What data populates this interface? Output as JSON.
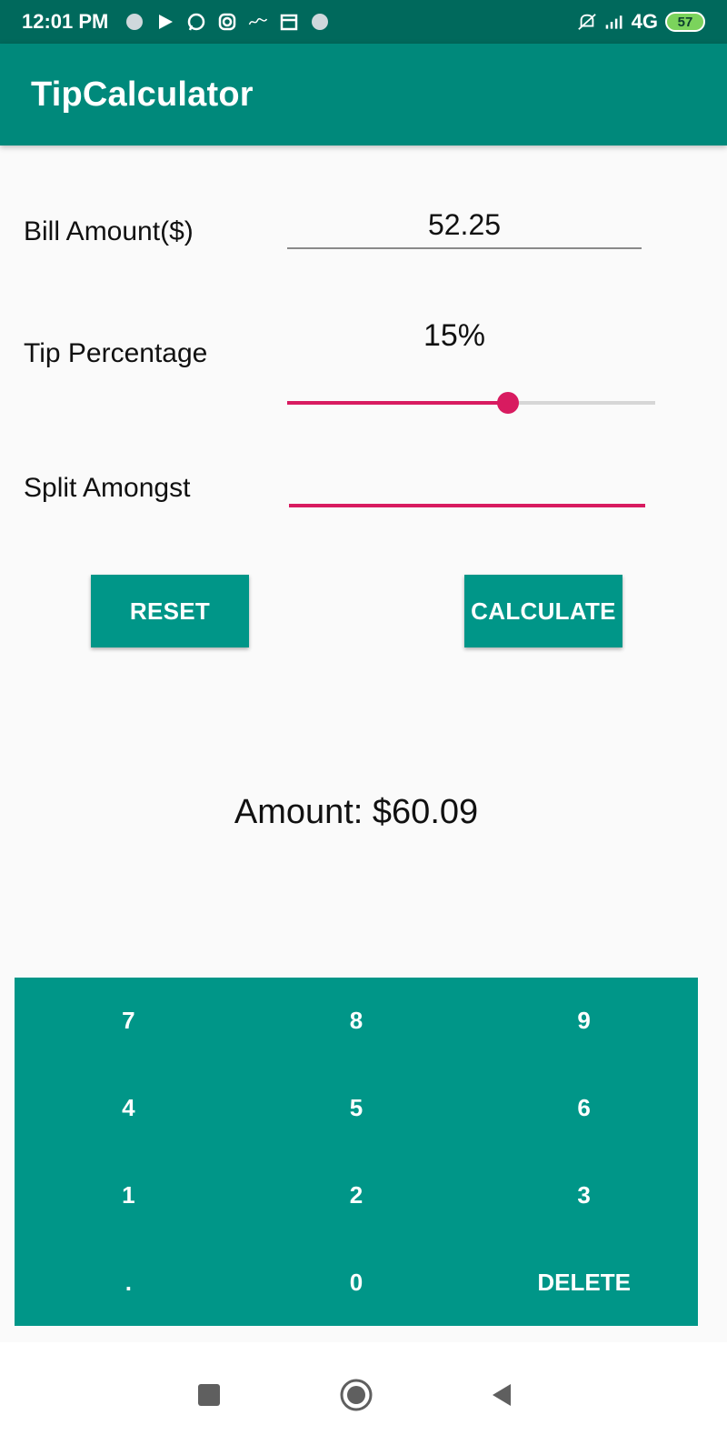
{
  "status_bar": {
    "time": "12:01 PM",
    "network": "4G",
    "battery": "57"
  },
  "app_bar": {
    "title": "TipCalculator"
  },
  "form": {
    "bill_label": "Bill Amount($)",
    "bill_value": "52.25",
    "tip_label": "Tip Percentage",
    "tip_value": "15%",
    "tip_slider_fraction": 0.6,
    "split_label": "Split Amongst",
    "split_value": ""
  },
  "buttons": {
    "reset": "RESET",
    "calculate": "CALCULATE"
  },
  "result": {
    "text": "Amount: $60.09"
  },
  "keypad": {
    "keys": [
      "7",
      "8",
      "9",
      "4",
      "5",
      "6",
      "1",
      "2",
      "3",
      ".",
      "0",
      "DELETE"
    ]
  },
  "colors": {
    "status_bar": "#00695c",
    "app_bar": "#00897b",
    "teal": "#009688",
    "accent": "#d81b60",
    "background": "#fafafa"
  },
  "icons": {
    "status_left": [
      "sync-icon",
      "play-store-icon",
      "whatsapp-icon",
      "instagram-icon",
      "flipkart-icon",
      "calendar-icon",
      "sync-icon"
    ],
    "status_right": [
      "mute-icon",
      "signal-icon",
      "battery-icon"
    ],
    "nav": [
      "recent-apps-icon",
      "home-icon",
      "back-icon"
    ]
  }
}
